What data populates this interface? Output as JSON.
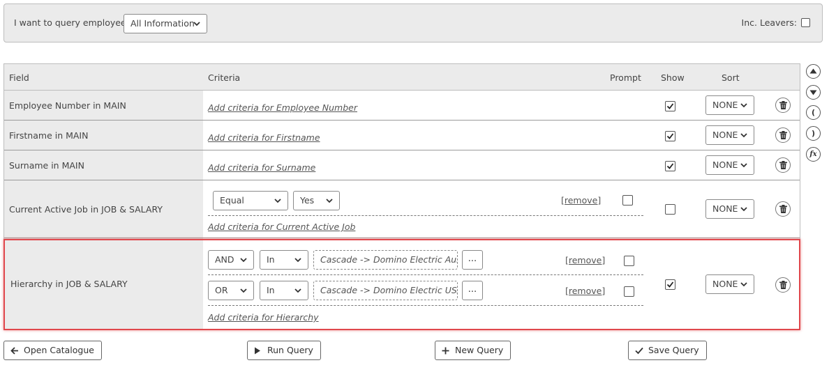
{
  "query_bar": {
    "label": "I want to query employees:",
    "query_type": "All Information",
    "inc_leavers_label": "Inc. Leavers:",
    "inc_leavers_checked": false
  },
  "columns": {
    "field": "Field",
    "criteria": "Criteria",
    "prompt": "Prompt",
    "show": "Show",
    "sort": "Sort"
  },
  "rows": [
    {
      "field": "Employee Number in MAIN",
      "add_criteria": "Add criteria for Employee Number",
      "show": true,
      "sort": "NONE"
    },
    {
      "field": "Firstname in MAIN",
      "add_criteria": "Add criteria for Firstname",
      "show": true,
      "sort": "NONE"
    },
    {
      "field": "Surname in MAIN",
      "add_criteria": "Add criteria for Surname",
      "show": true,
      "sort": "NONE"
    },
    {
      "field": "Current Active Job in JOB & SALARY",
      "criteria": [
        {
          "operator": "Equal",
          "value": "Yes",
          "remove": "[remove]",
          "prompt": false
        }
      ],
      "add_criteria": "Add criteria for Current Active Job",
      "show": false,
      "sort": "NONE"
    },
    {
      "field": "Hierarchy in JOB & SALARY",
      "criteria": [
        {
          "conjunction": "AND",
          "operator": "In",
          "value": "Cascade -> Domino Electric Austr...",
          "more": "...",
          "remove": "[remove]",
          "prompt": false
        },
        {
          "conjunction": "OR",
          "operator": "In",
          "value": "Cascade -> Domino Electric USA",
          "more": "...",
          "remove": "[remove]",
          "prompt": false
        }
      ],
      "add_criteria": "Add criteria for Hierarchy",
      "show": true,
      "sort": "NONE"
    }
  ],
  "side_controls": {
    "move_up": "move-up",
    "move_down": "move-down",
    "open_paren": "(",
    "close_paren": ")",
    "function": "fx"
  },
  "footer": {
    "open_catalogue": "Open Catalogue",
    "run_query": "Run Query",
    "new_query": "New Query",
    "save_query": "Save Query"
  }
}
